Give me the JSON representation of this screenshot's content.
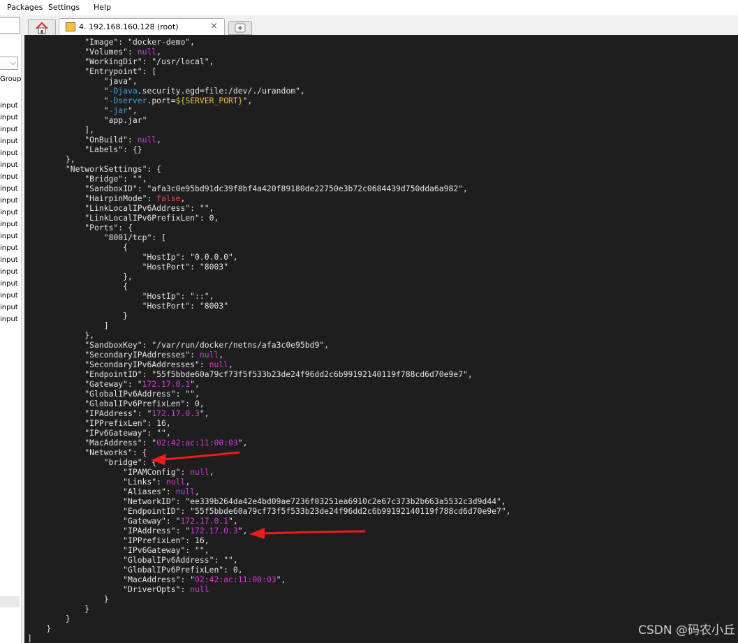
{
  "menu": {
    "items": [
      "Packages",
      "Settings",
      "Help"
    ]
  },
  "tabs": {
    "session_title": "4. 192.168.160.128 (root)",
    "close_glyph": "×",
    "home_icon": "home-icon",
    "new_tab_icon": "new-tab-icon"
  },
  "left_panel": {
    "dropdown_glyph": "⌵",
    "group_label": "Group",
    "row_label": "input",
    "row_count": 19
  },
  "terminal": {
    "lines": [
      [
        [
          "            \"Image\": \"docker-demo\",",
          ""
        ]
      ],
      [
        [
          "            \"Volumes\": ",
          ""
        ],
        [
          "null",
          "null"
        ],
        [
          ",",
          ""
        ]
      ],
      [
        [
          "            \"WorkingDir\": \"/usr/local\",",
          ""
        ]
      ],
      [
        [
          "            \"Entrypoint\": [",
          ""
        ]
      ],
      [
        [
          "                \"java\",",
          ""
        ]
      ],
      [
        [
          "                \"",
          ""
        ],
        [
          "-Djava",
          "flag"
        ],
        [
          ".security.egd=file:/dev/./urandom\",",
          ""
        ]
      ],
      [
        [
          "                \"",
          ""
        ],
        [
          "-Dserver",
          "flag"
        ],
        [
          ".port=",
          ""
        ],
        [
          "${SERVER_PORT}",
          "env"
        ],
        [
          "\",",
          ""
        ]
      ],
      [
        [
          "                \"",
          ""
        ],
        [
          "-jar",
          "flag"
        ],
        [
          "\",",
          ""
        ]
      ],
      [
        [
          "                \"app.jar\"",
          ""
        ]
      ],
      [
        [
          "            ],",
          ""
        ]
      ],
      [
        [
          "            \"OnBuild\": ",
          ""
        ],
        [
          "null",
          "null"
        ],
        [
          ",",
          ""
        ]
      ],
      [
        [
          "            \"Labels\": {}",
          ""
        ]
      ],
      [
        [
          "        },",
          ""
        ]
      ],
      [
        [
          "        \"NetworkSettings\": {",
          ""
        ]
      ],
      [
        [
          "            \"Bridge\": \"\",",
          ""
        ]
      ],
      [
        [
          "            \"SandboxID\": \"afa3c0e95bd91dc39f8bf4a420f89180de22750e3b72c0684439d750dda6a982\",",
          ""
        ]
      ],
      [
        [
          "            \"HairpinMode\": ",
          ""
        ],
        [
          "false",
          "false"
        ],
        [
          ",",
          ""
        ]
      ],
      [
        [
          "            \"LinkLocalIPv6Address\": \"\",",
          ""
        ]
      ],
      [
        [
          "            \"LinkLocalIPv6PrefixLen\": 0,",
          ""
        ]
      ],
      [
        [
          "            \"Ports\": {",
          ""
        ]
      ],
      [
        [
          "                \"8001/tcp\": [",
          ""
        ]
      ],
      [
        [
          "                    {",
          ""
        ]
      ],
      [
        [
          "                        \"HostIp\": \"0.0.0.0\",",
          ""
        ]
      ],
      [
        [
          "                        \"HostPort\": \"8003\"",
          ""
        ]
      ],
      [
        [
          "                    },",
          ""
        ]
      ],
      [
        [
          "                    {",
          ""
        ]
      ],
      [
        [
          "                        \"HostIp\": \"::\",",
          ""
        ]
      ],
      [
        [
          "                        \"HostPort\": \"8003\"",
          ""
        ]
      ],
      [
        [
          "                    }",
          ""
        ]
      ],
      [
        [
          "                ]",
          ""
        ]
      ],
      [
        [
          "            },",
          ""
        ]
      ],
      [
        [
          "            \"SandboxKey\": \"/var/run/docker/netns/afa3c0e95bd9\",",
          ""
        ]
      ],
      [
        [
          "            \"SecondaryIPAddresses\": ",
          ""
        ],
        [
          "null",
          "null"
        ],
        [
          ",",
          ""
        ]
      ],
      [
        [
          "            \"SecondaryIPv6Addresses\": ",
          ""
        ],
        [
          "null",
          "null"
        ],
        [
          ",",
          ""
        ]
      ],
      [
        [
          "            \"EndpointID\": \"55f5bbde60a79cf73f5f533b23de24f96dd2c6b99192140119f788cd6d70e9e7\",",
          ""
        ]
      ],
      [
        [
          "            \"Gateway\": \"",
          ""
        ],
        [
          "172.17.0.1",
          "ip"
        ],
        [
          "\",",
          ""
        ]
      ],
      [
        [
          "            \"GlobalIPv6Address\": \"\",",
          ""
        ]
      ],
      [
        [
          "            \"GlobalIPv6PrefixLen\": 0,",
          ""
        ]
      ],
      [
        [
          "            \"IPAddress\": \"",
          ""
        ],
        [
          "172.17.0.3",
          "ip"
        ],
        [
          "\",",
          ""
        ]
      ],
      [
        [
          "            \"IPPrefixLen\": 16,",
          ""
        ]
      ],
      [
        [
          "            \"IPv6Gateway\": \"\",",
          ""
        ]
      ],
      [
        [
          "            \"MacAddress\": \"",
          ""
        ],
        [
          "02:42:ac:11:00:03",
          "ip"
        ],
        [
          "\",",
          ""
        ]
      ],
      [
        [
          "            \"Networks\": {",
          ""
        ]
      ],
      [
        [
          "                \"bridge\": {",
          ""
        ]
      ],
      [
        [
          "                    \"IPAMConfig\": ",
          ""
        ],
        [
          "null",
          "null"
        ],
        [
          ",",
          ""
        ]
      ],
      [
        [
          "                    \"Links\": ",
          ""
        ],
        [
          "null",
          "null"
        ],
        [
          ",",
          ""
        ]
      ],
      [
        [
          "                    \"Aliases\": ",
          ""
        ],
        [
          "null",
          "null"
        ],
        [
          ",",
          ""
        ]
      ],
      [
        [
          "                    \"NetworkID\": \"ee339b264da42e4bd09ae7236f03251ea6910c2e67c373b2b663a5532c3d9d44\",",
          ""
        ]
      ],
      [
        [
          "                    \"EndpointID\": \"55f5bbde60a79cf73f5f533b23de24f96dd2c6b99192140119f788cd6d70e9e7\",",
          ""
        ]
      ],
      [
        [
          "                    \"Gateway\": \"",
          ""
        ],
        [
          "172.17.0.1",
          "ip"
        ],
        [
          "\",",
          ""
        ]
      ],
      [
        [
          "                    \"IPAddress\": \"",
          ""
        ],
        [
          "172.17.0.3",
          "ip"
        ],
        [
          "\",",
          ""
        ]
      ],
      [
        [
          "                    \"IPPrefixLen\": 16,",
          ""
        ]
      ],
      [
        [
          "                    \"IPv6Gateway\": \"\",",
          ""
        ]
      ],
      [
        [
          "                    \"GlobalIPv6Address\": \"\",",
          ""
        ]
      ],
      [
        [
          "                    \"GlobalIPv6PrefixLen\": 0,",
          ""
        ]
      ],
      [
        [
          "                    \"MacAddress\": \"",
          ""
        ],
        [
          "02:42:ac:11:00:03",
          "ip"
        ],
        [
          "\",",
          ""
        ]
      ],
      [
        [
          "                    \"DriverOpts\": ",
          ""
        ],
        [
          "null",
          "null"
        ]
      ],
      [
        [
          "                }",
          ""
        ]
      ],
      [
        [
          "            }",
          ""
        ]
      ],
      [
        [
          "        }",
          ""
        ]
      ],
      [
        [
          "    }",
          ""
        ]
      ],
      [
        [
          "]",
          ""
        ]
      ]
    ]
  },
  "watermark": "CSDN @码农小丘",
  "colors": {
    "terminal_bg": "#1e1e1e",
    "terminal_fg": "#e6e6e6",
    "null": "#d63bd6",
    "false": "#f0464a",
    "flag": "#3fa0d8",
    "env": "#e8c13a",
    "annotation_arrow": "#ee1c1c"
  }
}
